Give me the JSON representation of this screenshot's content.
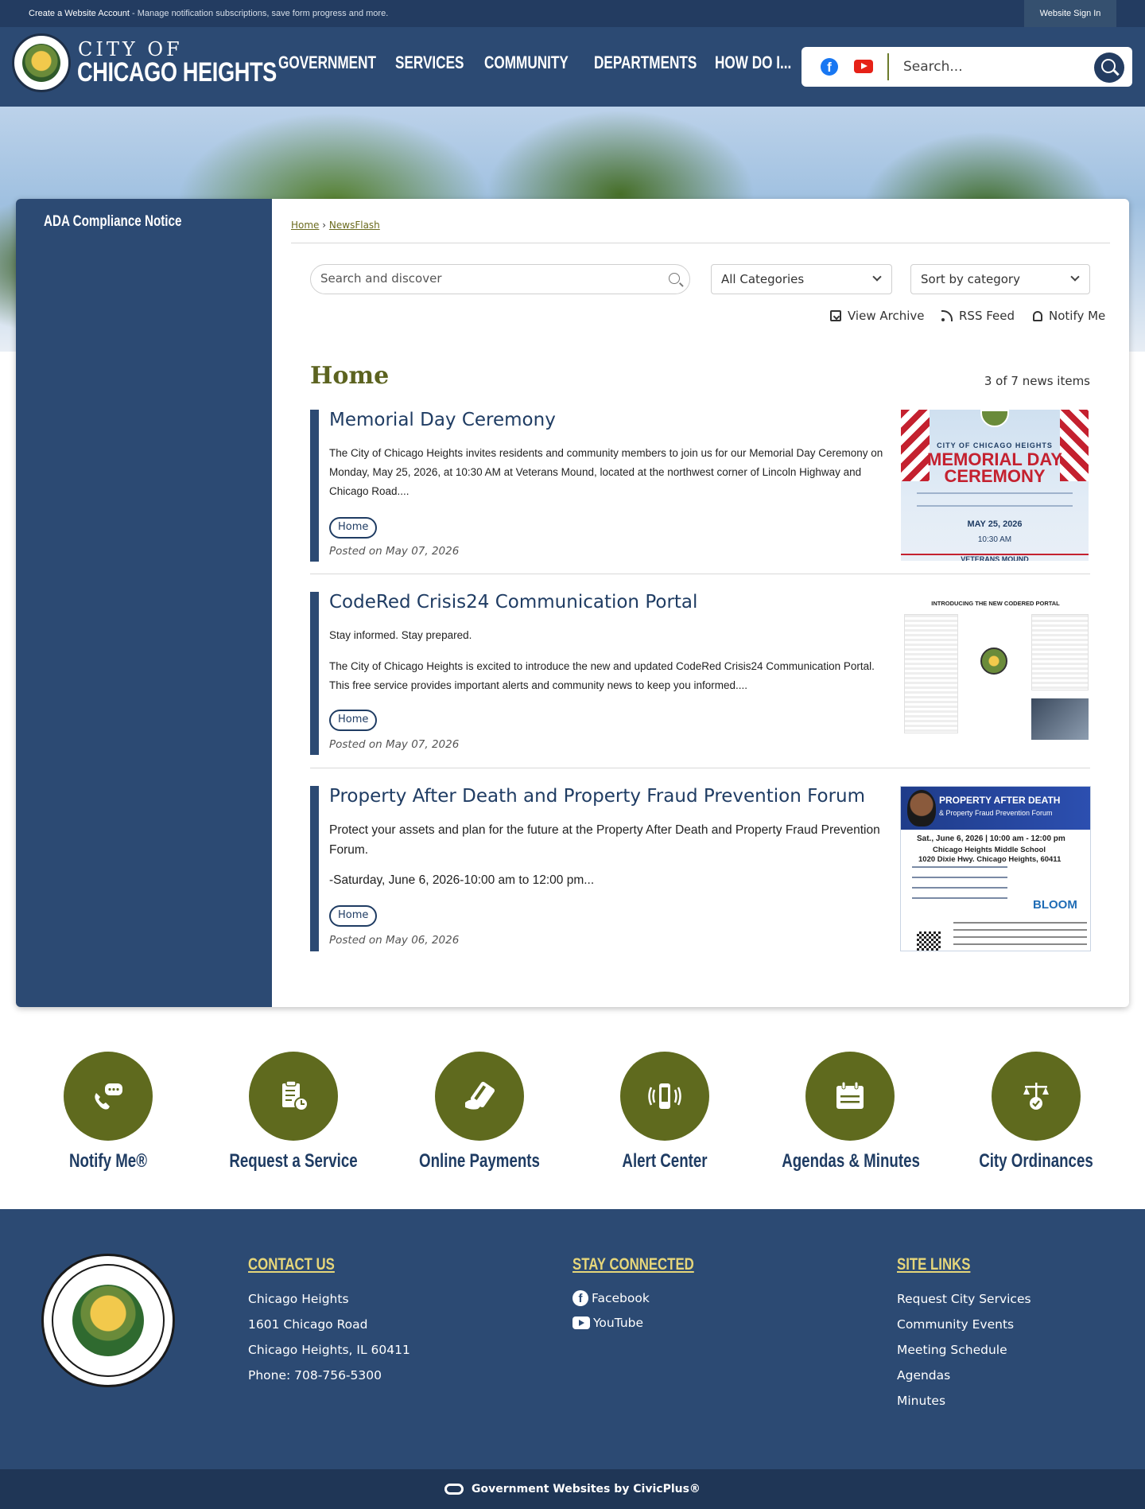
{
  "topbar": {
    "account_link": "Create a Website Account",
    "account_text": " - Manage notification subscriptions, save form progress and more.",
    "signin_label": "Website Sign In"
  },
  "header": {
    "logo_city": "CITY OF",
    "logo_name": "CHICAGO HEIGHTS",
    "nav": [
      "GOVERNMENT",
      "SERVICES",
      "COMMUNITY",
      "DEPARTMENTS",
      "HOW DO I..."
    ],
    "search_placeholder": "Search...",
    "social": [
      "facebook-icon",
      "youtube-icon"
    ]
  },
  "sidebar": {
    "items": [
      {
        "label": "ADA Compliance Notice"
      }
    ]
  },
  "breadcrumb": {
    "home": "Home",
    "separator": "›",
    "current": "NewsFlash"
  },
  "filters": {
    "search_placeholder": "Search and discover",
    "category": "All Categories",
    "sort": "Sort by category"
  },
  "actions": {
    "archive": "View Archive",
    "rss": "RSS Feed",
    "notify": "Notify Me"
  },
  "section": {
    "title": "Home",
    "count": "3 of 7 news items"
  },
  "news": [
    {
      "title": "Memorial Day Ceremony",
      "paragraphs": [
        "The City of Chicago Heights invites residents and community members to join us for our Memorial Day Ceremony on Monday, May 25, 2026, at 10:30 AM at Veterans Mound, located at the northwest corner of Lincoln Highway and Chicago Road...."
      ],
      "tag": "Home",
      "posted": "Posted on May 07, 2026",
      "thumb": {
        "city": "CITY OF CHICAGO HEIGHTS",
        "line1": "MEMORIAL DAY",
        "line2": "CEREMONY",
        "date": "MAY 25, 2026",
        "time": "10:30 AM",
        "place": "VETERANS MOUND"
      }
    },
    {
      "title": "CodeRed Crisis24 Communication Portal",
      "paragraphs": [
        "Stay informed. Stay prepared.",
        "The City of Chicago Heights is excited to introduce the new and updated CodeRed Crisis24 Communication Portal. This free service provides important alerts and community news to keep you informed...."
      ],
      "tag": "Home",
      "posted": "Posted on May 07, 2026",
      "thumb": {
        "header": "INTRODUCING THE NEW CODERED PORTAL"
      }
    },
    {
      "title": "Property After Death and Property Fraud Prevention Forum",
      "paragraphs": [
        "Protect your assets and plan for the future at the Property After Death and Property Fraud Prevention Forum.",
        "-Saturday, June 6, 2026-10:00 am to 12:00 pm..."
      ],
      "tag": "Home",
      "posted": "Posted on May 06, 2026",
      "thumb": {
        "banner1": "PROPERTY AFTER DEATH",
        "banner2": "& Property Fraud Prevention Forum",
        "line1": "Sat., June 6, 2026 | 10:00 am - 12:00 pm",
        "line2": "Chicago Heights Middle School",
        "line3": "1020 Dixie Hwy. Chicago Heights, 60411",
        "org": "BLOOM"
      }
    }
  ],
  "quick_links": [
    {
      "label": "Notify Me®",
      "icon": "chat-phone-icon"
    },
    {
      "label": "Request a Service",
      "icon": "clipboard-clock-icon"
    },
    {
      "label": "Online Payments",
      "icon": "card-hand-icon"
    },
    {
      "label": "Alert Center",
      "icon": "phone-vibrate-icon"
    },
    {
      "label": "Agendas & Minutes",
      "icon": "calendar-icon"
    },
    {
      "label": "City Ordinances",
      "icon": "scales-icon"
    }
  ],
  "footer": {
    "contact": {
      "heading": "CONTACT US",
      "lines": [
        "Chicago Heights",
        "1601 Chicago Road",
        "Chicago Heights, IL 60411",
        "Phone: 708-756-5300"
      ]
    },
    "stay": {
      "heading": "STAY CONNECTED",
      "links": [
        "Facebook",
        "YouTube"
      ]
    },
    "site": {
      "heading": "SITE LINKS",
      "links": [
        "Request City Services",
        "Community Events",
        "Meeting Schedule",
        "Agendas",
        "Minutes"
      ]
    },
    "credit": "Government Websites by CivicPlus®"
  },
  "colors": {
    "navy": "#2c4a73",
    "dark_navy": "#233c61",
    "olive": "#5f6a1e",
    "footer_heading": "#e6d67a"
  }
}
